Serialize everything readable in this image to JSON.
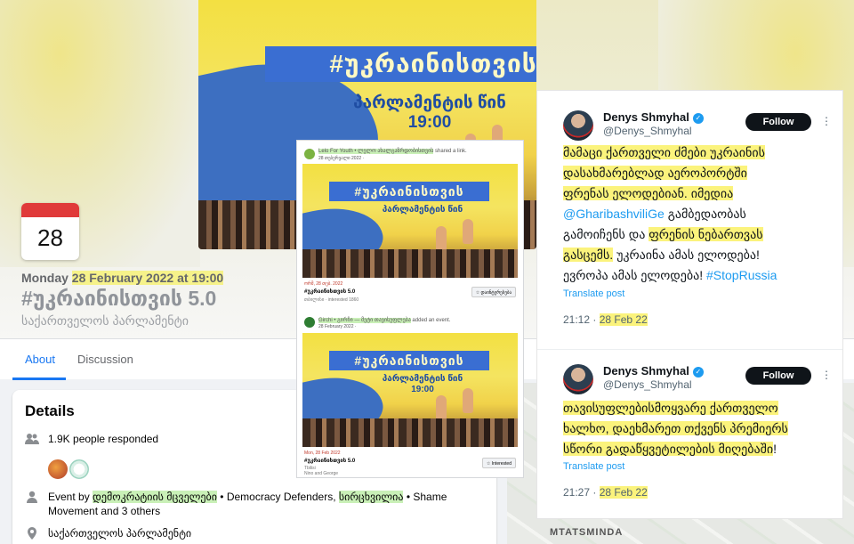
{
  "event": {
    "banner_hashtag": "#უკრაინისთვის",
    "banner_place": "პარლამენტის წინ",
    "banner_time": "19:00",
    "date_day": "28",
    "datetime_prefix": "Monday ",
    "datetime_highlight": "28 February 2022 at 19:00",
    "title": "#უკრაინისთვის 5.0",
    "location": "საქართველოს პარლამენტი"
  },
  "tabs": {
    "about": "About",
    "discussion": "Discussion"
  },
  "details": {
    "title": "Details",
    "responded": "1.9K people responded",
    "event_by_prefix": "Event by ",
    "host_1": "დემოკრატიის მცველები",
    "host_sep_1": " • Democracy Defenders, ",
    "host_2": "სირცხვილია",
    "host_sep_2": " • Shame Movement",
    "others": " and 3 others",
    "location": "საქართველოს პარლამენტი"
  },
  "map": {
    "label": "MTATSMINDA"
  },
  "posts": [
    {
      "author": "Lelo For Youth • ლელო ახალგაზრდობისთვის",
      "action": " shared a link.",
      "date": "28 თებერვალი 2022 · ",
      "card_date": "ორშ, 28 თებ. 2022",
      "card_title": "#უკრაინისთვის 5.0",
      "card_sub": "თბილისი · interested 1860",
      "card_button": "☆ დაინტერესება"
    },
    {
      "author": "Girchi • გირჩი — მეტი თავისუფლება",
      "action": " added an event.",
      "date": "28 February 2022 · ",
      "card_date": "Mon, 28 Feb 2022",
      "card_title": "#უკრაინისთვის 5.0",
      "card_sub": "Tbilisi",
      "card_sub2": "Nino and George",
      "card_button": "☆ Interested"
    }
  ],
  "tweets": [
    {
      "name": "Denys Shmyhal",
      "handle": "@Denys_Shmyhal",
      "follow": "Follow",
      "more": "⋮",
      "line1": "მამაცი ქართველი ძმები უკრაინის",
      "line2": "დასახმარებლად აეროპორტში",
      "line3": "ფრენას ელოდებიან. იმედია",
      "mention": "@GharibashviliGe",
      "line4_rest": " გამბედაობას",
      "line5": "გამოიჩენს და ",
      "line5_hl": "ფრენის ნებართვას",
      "line6_hl": "გასცემს.",
      "line6_rest": " უკრაინა ამას ელოდება!",
      "line7": "ევროპა ამას ელოდება! ",
      "hashtag": "#StopRussia",
      "translate": "Translate post",
      "time": "21:12 · ",
      "date": "28 Feb 22"
    },
    {
      "name": "Denys Shmyhal",
      "handle": "@Denys_Shmyhal",
      "follow": "Follow",
      "more": "⋮",
      "line1": "თავისუფლებისმოყვარე ქართველო",
      "line2": "ხალხო, დაეხმარეთ თქვენს პრემიერს",
      "line3": "სწორი გადაწყვეტილების მიღებაში",
      "line3_end": "!",
      "translate": "Translate post",
      "time": "21:27 · ",
      "date": "28 Feb 22"
    }
  ]
}
